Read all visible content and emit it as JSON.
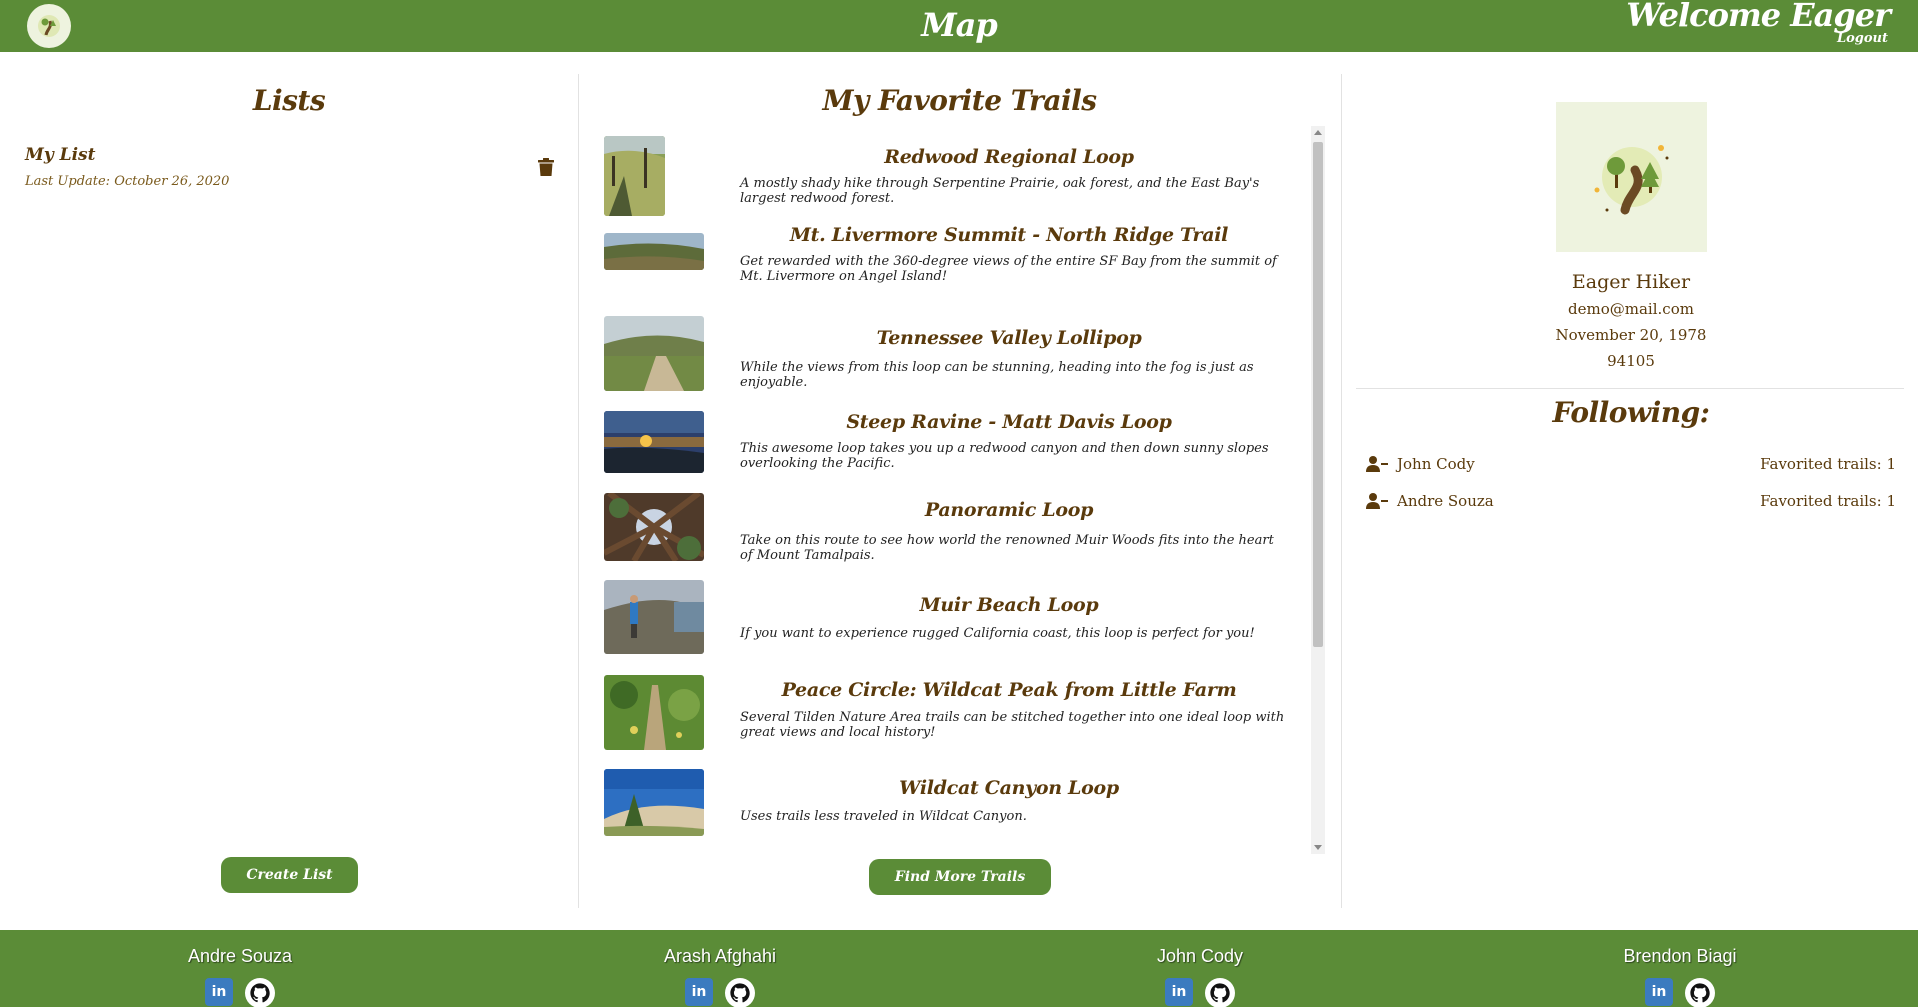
{
  "header": {
    "title": "Map",
    "welcome": "Welcome Eager",
    "logout": "Logout"
  },
  "lists": {
    "title": "Lists",
    "items": [
      {
        "name": "My List",
        "updated": "Last Update: October 26, 2020"
      }
    ],
    "create_label": "Create List"
  },
  "favorites": {
    "title": "My Favorite Trails",
    "find_more_label": "Find More Trails",
    "trails": [
      {
        "title": "Redwood Regional Loop",
        "description": "A mostly shady hike through Serpentine Prairie, oak forest, and the East Bay's largest redwood forest."
      },
      {
        "title": "Mt. Livermore Summit - North Ridge Trail",
        "description": "Get rewarded with the 360-degree views of the entire SF Bay from the summit of Mt. Livermore on Angel Island!"
      },
      {
        "title": "Tennessee Valley Lollipop",
        "description": "While the views from this loop can be stunning, heading into the fog is just as enjoyable."
      },
      {
        "title": "Steep Ravine - Matt Davis Loop",
        "description": "This awesome loop takes you up a redwood canyon and then down sunny slopes overlooking the Pacific."
      },
      {
        "title": "Panoramic Loop",
        "description": "Take on this route to see how world the renowned Muir Woods fits into the heart of Mount Tamalpais."
      },
      {
        "title": "Muir Beach Loop",
        "description": "If you want to experience rugged California coast, this loop is perfect for you!"
      },
      {
        "title": "Peace Circle: Wildcat Peak from Little Farm",
        "description": "Several Tilden Nature Area trails can be stitched together into one ideal loop with great views and local history!"
      },
      {
        "title": "Wildcat Canyon Loop",
        "description": "Uses trails less traveled in Wildcat Canyon."
      }
    ]
  },
  "profile": {
    "name": "Eager Hiker",
    "email": "demo@mail.com",
    "birthday": "November 20, 1978",
    "zip": "94105",
    "following_title": "Following:",
    "following": [
      {
        "name": "John Cody",
        "count": "Favorited trails: 1"
      },
      {
        "name": "Andre Souza",
        "count": "Favorited trails: 1"
      }
    ]
  },
  "footer": {
    "developers": [
      {
        "name": "Andre Souza"
      },
      {
        "name": "Arash Afghahi"
      },
      {
        "name": "John Cody"
      },
      {
        "name": "Brendon Biagi"
      }
    ],
    "linkedin_text": "in"
  },
  "colors": {
    "brand_green": "#5b8c37",
    "brown_text": "#5a3a0c"
  }
}
